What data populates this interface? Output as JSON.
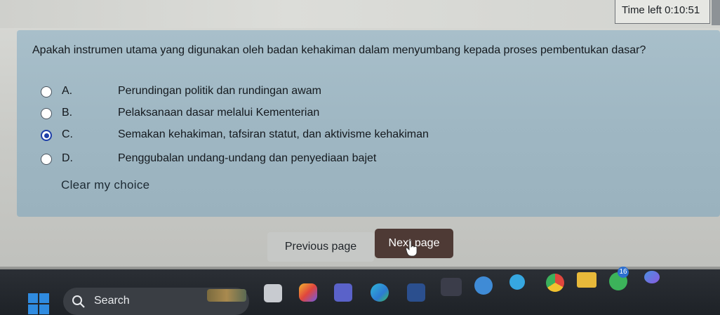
{
  "timer": {
    "label": "Time left",
    "value": "0:10:51"
  },
  "question": {
    "text": "Apakah instrumen utama yang digunakan oleh badan kehakiman dalam menyumbang kepada proses pembentukan dasar?",
    "options": [
      {
        "letter": "A.",
        "text": "Perundingan politik dan rundingan awam",
        "selected": false
      },
      {
        "letter": "B.",
        "text": "Pelaksanaan dasar melalui Kementerian",
        "selected": false
      },
      {
        "letter": "C.",
        "text": "Semakan kehakiman, tafsiran statut, dan aktivisme kehakiman",
        "selected": true
      },
      {
        "letter": "D.",
        "text": "Penggubalan undang-undang dan penyediaan bajet",
        "selected": false
      }
    ],
    "clear_label": "Clear my choice"
  },
  "navigation": {
    "previous_label": "Previous page",
    "next_label": "Next page"
  },
  "taskbar": {
    "search_label": "Search",
    "badges": {
      "mail_count": "16"
    },
    "icons": [
      "windows-start-icon",
      "search-icon",
      "widgets-icon",
      "file-explorer-icon",
      "photos-icon",
      "teams-icon",
      "edge-icon",
      "store-icon",
      "mahjong-icon",
      "help-icon",
      "telegram-icon",
      "chrome-icon",
      "folder-icon",
      "whatsapp-icon",
      "copilot-icon"
    ],
    "colors": {
      "accent": "#2f8be0",
      "taskbar_bg": "#1e2227"
    }
  },
  "colors": {
    "card_bg": "#a8bfca",
    "next_button": "#4e3a35",
    "prev_button": "#c6c8c6",
    "radio_selected": "#1f3fa8"
  }
}
